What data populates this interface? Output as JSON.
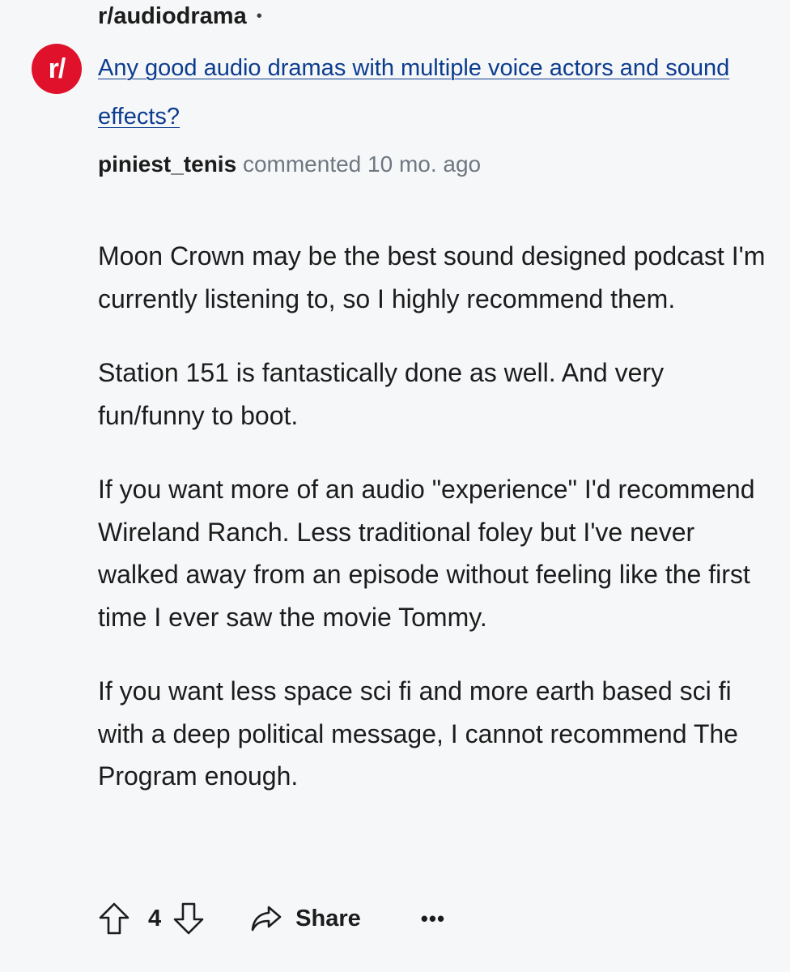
{
  "post": {
    "subreddit": "r/audiodrama",
    "separator": "•",
    "avatar_text": "r/",
    "title": "Any good audio dramas with multiple voice actors and sound effects?"
  },
  "comment": {
    "username": "piniest_tenis",
    "meta": "commented 10 mo. ago",
    "paragraphs": [
      "Moon Crown may be the best sound designed podcast I'm currently listening to, so I highly recommend them.",
      "Station 151 is fantastically done as well. And very fun/funny to boot.",
      "If you want more of an audio \"experience\" I'd recommend Wireland Ranch. Less traditional foley but I've never walked away from an episode without feeling like the first time I ever saw the movie Tommy.",
      "If you want less space sci fi and more earth based sci fi with a deep political message, I cannot recommend The Program enough."
    ]
  },
  "actions": {
    "upvote_icon": "arrow-up-icon",
    "vote_count": "4",
    "downvote_icon": "arrow-down-icon",
    "share_icon": "share-arrow-icon",
    "share_label": "Share",
    "more_label": "•••"
  },
  "colors": {
    "background": "#f6f7f8",
    "avatar": "#e0112b",
    "link": "#0c3c8f",
    "meta": "#6f7781",
    "text": "#1c1c1c"
  }
}
